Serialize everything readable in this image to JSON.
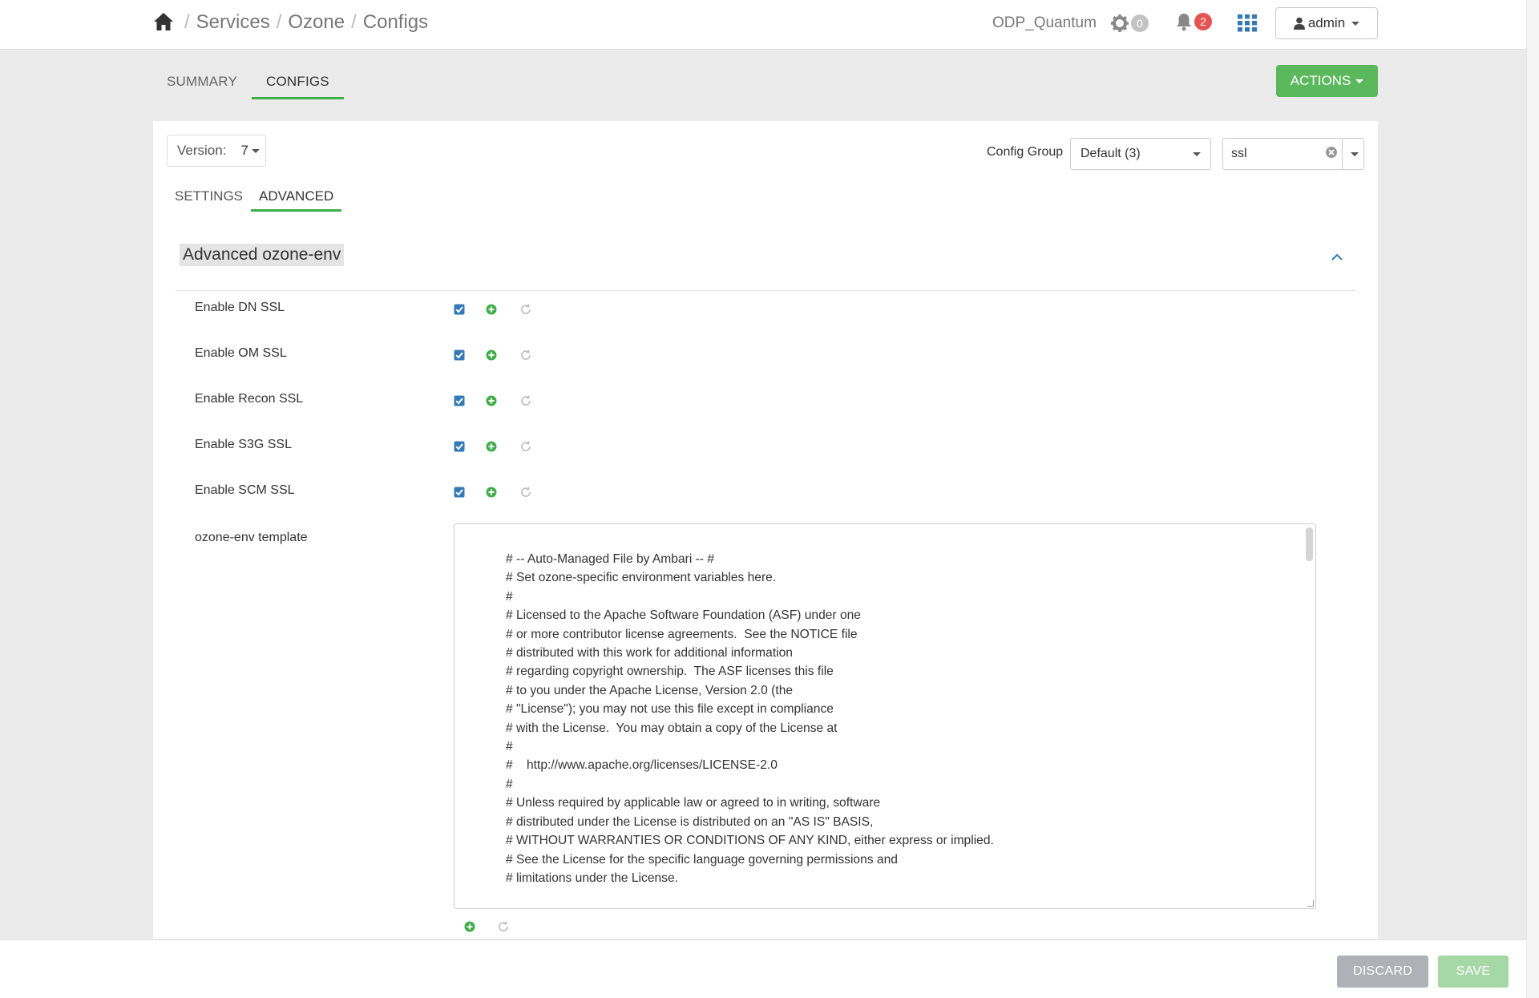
{
  "header": {
    "breadcrumb": [
      "Services",
      "Ozone",
      "Configs"
    ],
    "separator": "/",
    "cluster_name": "ODP_Quantum",
    "ops_count": "0",
    "alerts_count": "2",
    "user_label": "admin"
  },
  "service_tabs": [
    {
      "label": "SUMMARY",
      "active": false
    },
    {
      "label": "CONFIGS",
      "active": true
    }
  ],
  "actions_label": "ACTIONS",
  "version": {
    "label": "Version:",
    "value": "7"
  },
  "config_group": {
    "label": "Config Group",
    "selected": "Default (3)"
  },
  "filter": {
    "value": "ssl"
  },
  "sub_tabs": [
    {
      "label": "SETTINGS",
      "active": false
    },
    {
      "label": "ADVANCED",
      "active": true
    }
  ],
  "section": {
    "title": "Advanced ozone-env"
  },
  "properties": [
    {
      "label": "Enable DN SSL",
      "checked": true
    },
    {
      "label": "Enable OM SSL",
      "checked": true
    },
    {
      "label": "Enable Recon SSL",
      "checked": true
    },
    {
      "label": "Enable S3G SSL",
      "checked": true
    },
    {
      "label": "Enable SCM SSL",
      "checked": true
    }
  ],
  "template": {
    "label": "ozone-env template",
    "content": "# -- Auto-Managed File by Ambari -- #\n# Set ozone-specific environment variables here.\n#\n# Licensed to the Apache Software Foundation (ASF) under one\n# or more contributor license agreements.  See the NOTICE file\n# distributed with this work for additional information\n# regarding copyright ownership.  The ASF licenses this file\n# to you under the Apache License, Version 2.0 (the\n# \"License\"); you may not use this file except in compliance\n# with the License.  You may obtain a copy of the License at\n#\n#    http://www.apache.org/licenses/LICENSE-2.0\n#\n# Unless required by applicable law or agreed to in writing, software\n# distributed under the License is distributed on an \"AS IS\" BASIS,\n# WITHOUT WARRANTIES OR CONDITIONS OF ANY KIND, either express or implied.\n# See the License for the specific language governing permissions and\n# limitations under the License.\n\n# Set Ozone-specific environment variables here."
  },
  "footer": {
    "discard_label": "DISCARD",
    "save_label": "SAVE"
  },
  "colors": {
    "accent_green": "#5cb85c",
    "alert_red": "#e65353",
    "checkbox_blue": "#337ab7"
  }
}
